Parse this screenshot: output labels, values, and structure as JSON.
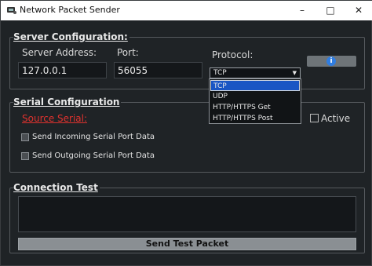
{
  "window": {
    "title": "Network Packet Sender",
    "minimize": "–",
    "maximize": "□",
    "close": "✕"
  },
  "server": {
    "section_title": "Server Configuration:",
    "address_label": "Server Address:",
    "address_value": "127.0.0.1",
    "port_label": "Port:",
    "port_value": "56055",
    "protocol_label": "Protocol:",
    "protocol_selected": "TCP",
    "protocol_options": [
      "TCP",
      "UDP",
      "HTTP/HTTPS Get",
      "HTTP/HTTPS Post"
    ],
    "info_icon": "i"
  },
  "serial": {
    "section_title": "Serial Configuration",
    "source_label": "Source Serial:",
    "active_label": "Active",
    "send_incoming_label": "Send Incoming Serial Port Data",
    "send_outgoing_label": "Send Outgoing Serial Port Data"
  },
  "connection": {
    "section_title": "Connection Test",
    "send_button": "Send Test Packet"
  },
  "colors": {
    "background": "#1f2326",
    "accent": "#1a56c4",
    "error_red": "#e0322e",
    "info_blue": "#2f7de1"
  }
}
